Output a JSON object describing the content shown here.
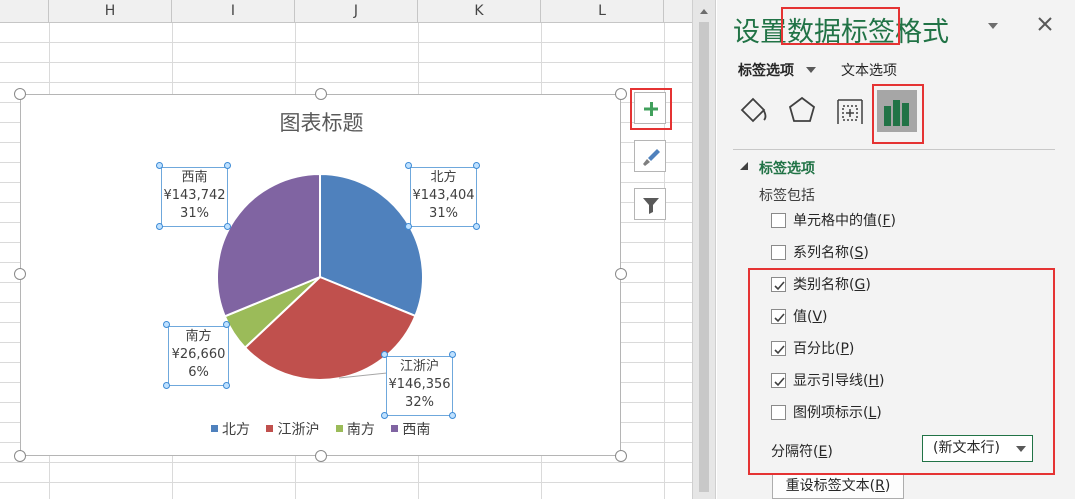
{
  "sheet": {
    "columns": [
      "H",
      "I",
      "J",
      "K",
      "L"
    ]
  },
  "chart": {
    "title": "图表标题",
    "colors": {
      "north": "#4f81bd",
      "east": "#c0504d",
      "south": "#9bbb59",
      "southwest": "#8064a2"
    },
    "labels": [
      {
        "category": "西南",
        "value": "¥143,742",
        "percent": "31%"
      },
      {
        "category": "北方",
        "value": "¥143,404",
        "percent": "31%"
      },
      {
        "category": "南方",
        "value": "¥26,660",
        "percent": "6%"
      },
      {
        "category": "江浙沪",
        "value": "¥146,356",
        "percent": "32%"
      }
    ],
    "legend": [
      "北方",
      "江浙沪",
      "南方",
      "西南"
    ]
  },
  "chart_data": {
    "type": "pie",
    "title": "图表标题",
    "categories": [
      "北方",
      "江浙沪",
      "南方",
      "西南"
    ],
    "values": [
      143404,
      146356,
      26660,
      143742
    ],
    "percent_labels": [
      "31%",
      "32%",
      "6%",
      "31%"
    ],
    "legend_position": "bottom"
  },
  "side_buttons": {
    "add": "plus-icon",
    "style": "brush-icon",
    "filter": "filter-icon"
  },
  "pane": {
    "title": "设置数据标签格式",
    "tabs": {
      "label_options": "标签选项",
      "text_options": "文本选项"
    },
    "section": "标签选项",
    "contains": "标签包括",
    "options": [
      {
        "label": "单元格中的值(",
        "key": "F",
        "end": ")",
        "checked": false
      },
      {
        "label": "系列名称(",
        "key": "S",
        "end": ")",
        "checked": false
      },
      {
        "label": "类别名称(",
        "key": "G",
        "end": ")",
        "checked": true
      },
      {
        "label": "值(",
        "key": "V",
        "end": ")",
        "checked": true
      },
      {
        "label": "百分比(",
        "key": "P",
        "end": ")",
        "checked": true
      },
      {
        "label": "显示引导线(",
        "key": "H",
        "end": ")",
        "checked": true
      },
      {
        "label": "图例项标示(",
        "key": "L",
        "end": ")",
        "checked": false
      }
    ],
    "separator_label": "分隔符(",
    "separator_key": "E",
    "separator_end": ")",
    "separator_value": "(新文本行)",
    "reset_label": "重设标签文本(",
    "reset_key": "R",
    "reset_end": ")"
  }
}
